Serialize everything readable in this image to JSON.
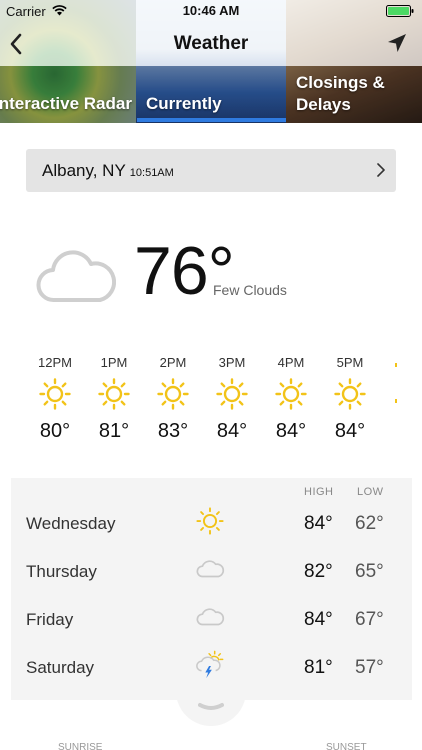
{
  "status": {
    "carrier": "Carrier",
    "time": "10:46 AM"
  },
  "nav": {
    "title": "Weather"
  },
  "tabs": [
    {
      "label": "Interactive Radar"
    },
    {
      "label": "Currently"
    },
    {
      "label_line1": "Closings &",
      "label_line2": "Delays"
    }
  ],
  "location": {
    "city": "Albany, NY",
    "updated": "10:51AM"
  },
  "current": {
    "temp": "76°",
    "condition": "Few Clouds",
    "icon": "cloud-icon"
  },
  "hourly": [
    {
      "hour": "12PM",
      "temp": "80°",
      "icon": "sun-icon"
    },
    {
      "hour": "1PM",
      "temp": "81°",
      "icon": "sun-icon"
    },
    {
      "hour": "2PM",
      "temp": "83°",
      "icon": "sun-icon"
    },
    {
      "hour": "3PM",
      "temp": "84°",
      "icon": "sun-icon"
    },
    {
      "hour": "4PM",
      "temp": "84°",
      "icon": "sun-icon"
    },
    {
      "hour": "5PM",
      "temp": "84°",
      "icon": "sun-icon"
    }
  ],
  "daily": {
    "high_label": "HIGH",
    "low_label": "LOW",
    "rows": [
      {
        "day": "Wednesday",
        "icon": "sun-icon",
        "high": "84°",
        "low": "62°"
      },
      {
        "day": "Thursday",
        "icon": "cloud-icon",
        "high": "82°",
        "low": "65°"
      },
      {
        "day": "Friday",
        "icon": "cloud-icon",
        "high": "84°",
        "low": "67°"
      },
      {
        "day": "Saturday",
        "icon": "thunderstorm-sun-icon",
        "high": "81°",
        "low": "57°"
      }
    ]
  },
  "footer": {
    "sunrise": "SUNRISE",
    "sunset": "SUNSET"
  },
  "colors": {
    "accent": "#2f7be0",
    "sun": "#f2c318",
    "cloud": "#c9c9c9"
  }
}
